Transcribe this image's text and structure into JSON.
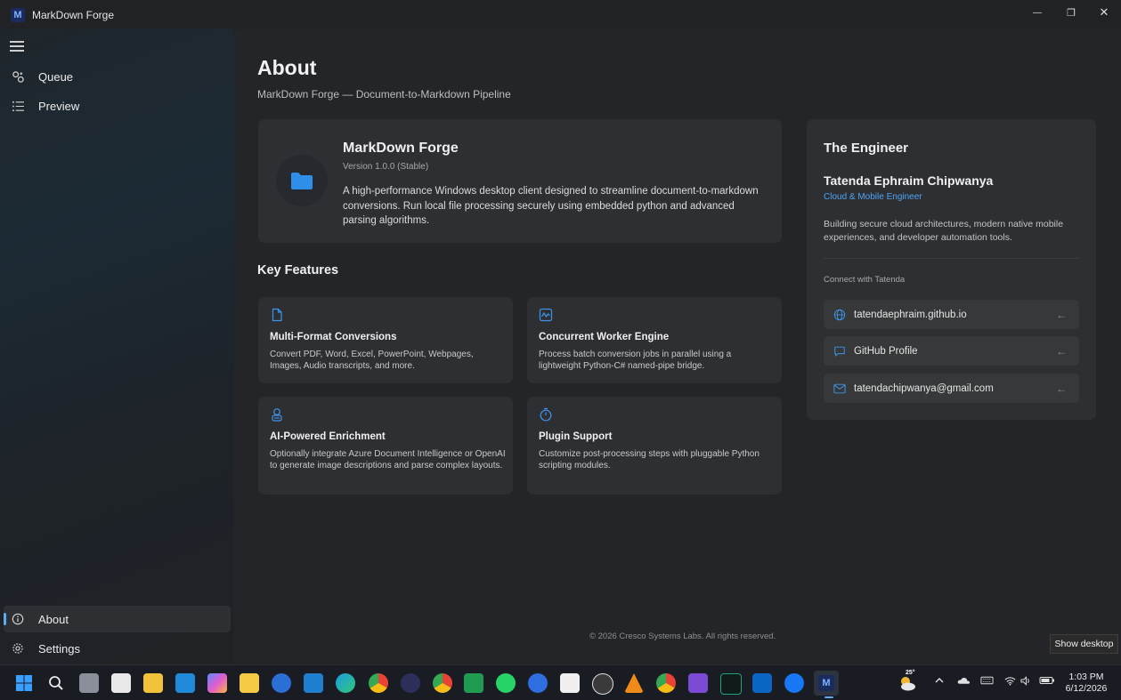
{
  "window": {
    "title": "MarkDown Forge",
    "logo_letter": "M",
    "minimize_glyph": "—",
    "restore_glyph": "❐",
    "close_glyph": "✕"
  },
  "sidebar": {
    "items": [
      {
        "label": "Queue",
        "icon": "queue-icon"
      },
      {
        "label": "Preview",
        "icon": "list-icon"
      }
    ],
    "footer_items": [
      {
        "label": "About",
        "icon": "info-icon",
        "selected": true
      },
      {
        "label": "Settings",
        "icon": "gear-icon"
      }
    ]
  },
  "about": {
    "title": "About",
    "subtitle": "MarkDown Forge — Document-to-Markdown Pipeline",
    "app_card": {
      "name": "MarkDown Forge",
      "version": "Version 1.0.0 (Stable)",
      "description": "A high-performance Windows desktop client designed to streamline document-to-markdown conversions. Run local file processing securely using embedded python and advanced parsing algorithms."
    },
    "features_title": "Key Features",
    "features": [
      {
        "icon": "document-icon",
        "title": "Multi-Format Conversions",
        "description": "Convert PDF, Word, Excel, PowerPoint, Webpages, Images, Audio transcripts, and more."
      },
      {
        "icon": "pulse-icon",
        "title": "Concurrent Worker Engine",
        "description": "Process batch conversion jobs in parallel using a lightweight Python-C# named-pipe bridge."
      },
      {
        "icon": "robot-icon",
        "title": "AI-Powered Enrichment",
        "description": "Optionally integrate Azure Document Intelligence or OpenAI to generate image descriptions and parse complex layouts."
      },
      {
        "icon": "timer-icon",
        "title": "Plugin Support",
        "description": "Customize post-processing steps with pluggable Python scripting modules."
      }
    ],
    "engineer": {
      "heading": "The Engineer",
      "name": "Tatenda Ephraim Chipwanya",
      "role": "Cloud & Mobile Engineer",
      "bio": "Building secure cloud architectures, modern native mobile experiences, and developer automation tools.",
      "connect_label": "Connect with Tatenda",
      "links": [
        {
          "icon": "globe-icon",
          "label": "tatendaephraim.github.io"
        },
        {
          "icon": "chat-icon",
          "label": "GitHub Profile"
        },
        {
          "icon": "mail-icon",
          "label": "tatendachipwanya@gmail.com"
        }
      ],
      "link_arrow": "←"
    },
    "footer": "© 2026 Cresco Systems Labs. All rights reserved."
  },
  "tooltip": "Show desktop",
  "taskbar": {
    "weather_temp": "25°",
    "time": "1:03 PM",
    "date": "6/12/2026"
  },
  "colors": {
    "accent": "#4ea3f0",
    "window_bg": "#202226",
    "card_bg": "#2d2f33"
  }
}
